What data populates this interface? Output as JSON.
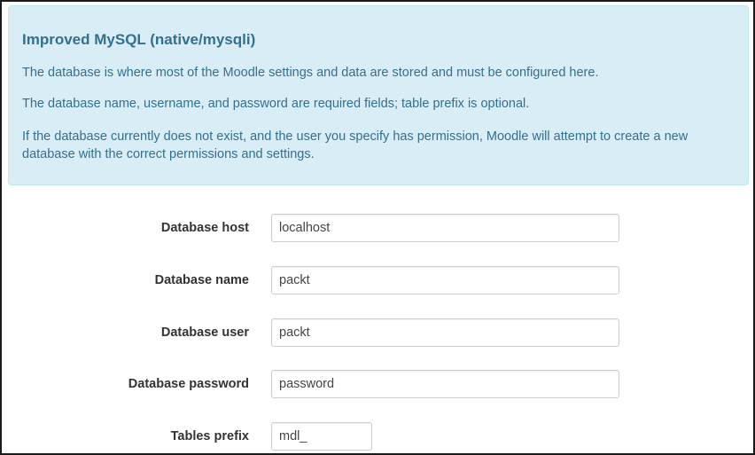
{
  "notice": {
    "title": "Improved MySQL (native/mysqli)",
    "paragraphs": [
      "The database is where most of the Moodle settings and data are stored and must be configured here.",
      "The database name, username, and password are required fields; table prefix is optional.",
      "If the database currently does not exist, and the user you specify has permission, Moodle will attempt to create a new database with the correct permissions and settings."
    ]
  },
  "form": {
    "fields": [
      {
        "label": "Database host",
        "value": "localhost"
      },
      {
        "label": "Database name",
        "value": "packt"
      },
      {
        "label": "Database user",
        "value": "packt"
      },
      {
        "label": "Database password",
        "value": "password"
      },
      {
        "label": "Tables prefix",
        "value": "mdl_"
      }
    ]
  },
  "colors": {
    "info_background": "#d9edf7",
    "info_border": "#bce8f1",
    "info_text": "#31708f"
  }
}
